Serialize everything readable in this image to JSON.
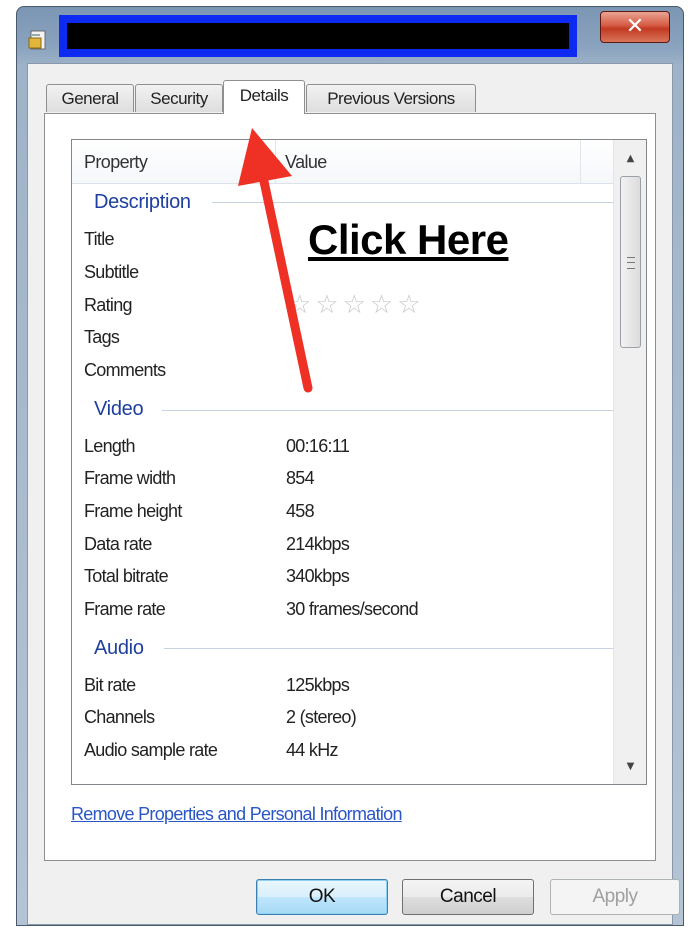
{
  "dialog": {
    "close_glyph": "✕"
  },
  "tabs": [
    {
      "label": "General"
    },
    {
      "label": "Security"
    },
    {
      "label": "Details"
    },
    {
      "label": "Previous Versions"
    }
  ],
  "list": {
    "header_property": "Property",
    "header_value": "Value",
    "groups": {
      "description": "Description",
      "video": "Video",
      "audio": "Audio"
    },
    "rows": {
      "title": {
        "label": "Title",
        "value": ""
      },
      "subtitle": {
        "label": "Subtitle",
        "value": ""
      },
      "rating": {
        "label": "Rating",
        "stars": "☆☆☆☆☆",
        "rating_value": 0
      },
      "tags": {
        "label": "Tags",
        "value": ""
      },
      "comments": {
        "label": "Comments",
        "value": ""
      },
      "length": {
        "label": "Length",
        "value": "00:16:11"
      },
      "frame_width": {
        "label": "Frame width",
        "value": "854"
      },
      "frame_height": {
        "label": "Frame height",
        "value": "458"
      },
      "data_rate": {
        "label": "Data rate",
        "value": "214kbps"
      },
      "total_bitrate": {
        "label": "Total bitrate",
        "value": "340kbps"
      },
      "frame_rate": {
        "label": "Frame rate",
        "value": "30 frames/second"
      },
      "bit_rate": {
        "label": "Bit rate",
        "value": "125kbps"
      },
      "channels": {
        "label": "Channels",
        "value": "2 (stereo)"
      },
      "audio_sample_rate": {
        "label": "Audio sample rate",
        "value": "44 kHz"
      }
    }
  },
  "annotation": {
    "callout_text": "Click Here",
    "arrow_color": "#ee3124"
  },
  "footer": {
    "link_text": "Remove Properties and Personal Information",
    "ok_label": "OK",
    "cancel_label": "Cancel",
    "apply_label": "Apply"
  },
  "colors": {
    "group_header": "#1e3f9e",
    "link": "#2a56c6",
    "title_redaction": "#0e2af0",
    "close_button": "#c23a22"
  },
  "icons": {
    "app": "file-properties-icon",
    "close": "close-icon",
    "scroll_up": "scroll-up-arrow-icon",
    "scroll_down": "scroll-down-arrow-icon"
  }
}
